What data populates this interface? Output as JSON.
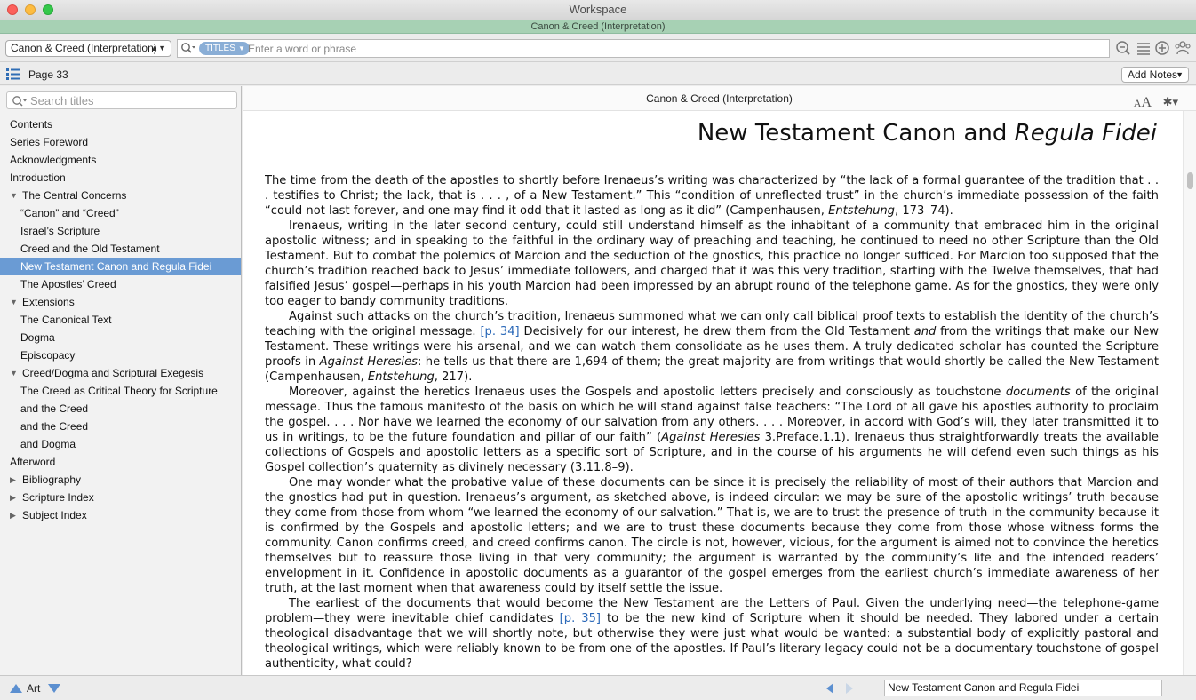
{
  "window": {
    "title": "Workspace",
    "panel_title": "Canon & Creed (Interpretation)"
  },
  "toolbar": {
    "resource_select": "Canon & Creed (Interpretation)",
    "search_scope": "TITLES",
    "search_placeholder": "Enter a word or phrase"
  },
  "pagebar": {
    "page_label": "Page 33",
    "add_notes": "Add Notes"
  },
  "sidebar": {
    "search_placeholder": "Search titles",
    "items": [
      {
        "label": "Contents",
        "level": 0,
        "arrow": "",
        "selected": false
      },
      {
        "label": "Series Foreword",
        "level": 0,
        "arrow": "",
        "selected": false
      },
      {
        "label": "Acknowledgments",
        "level": 0,
        "arrow": "",
        "selected": false
      },
      {
        "label": "Introduction",
        "level": 0,
        "arrow": "",
        "selected": false
      },
      {
        "label": "The Central Concerns",
        "level": 1,
        "arrow": "▼",
        "selected": false
      },
      {
        "label": "“Canon” and “Creed”",
        "level": 2,
        "arrow": "",
        "selected": false
      },
      {
        "label": "Israel’s Scripture",
        "level": 2,
        "arrow": "",
        "selected": false
      },
      {
        "label": "Creed and the Old Testament",
        "level": 2,
        "arrow": "",
        "selected": false
      },
      {
        "label": "New Testament Canon and Regula Fidei",
        "level": 2,
        "arrow": "",
        "selected": true
      },
      {
        "label": "The Apostles’ Creed",
        "level": 2,
        "arrow": "",
        "selected": false
      },
      {
        "label": "Extensions",
        "level": 1,
        "arrow": "▼",
        "selected": false
      },
      {
        "label": "The Canonical Text",
        "level": 2,
        "arrow": "",
        "selected": false
      },
      {
        "label": "Dogma",
        "level": 2,
        "arrow": "",
        "selected": false
      },
      {
        "label": "Episcopacy",
        "level": 2,
        "arrow": "",
        "selected": false
      },
      {
        "label": "Creed/Dogma and Scriptural Exegesis",
        "level": 1,
        "arrow": "▼",
        "selected": false
      },
      {
        "label": "The Creed as Critical Theory for Scripture",
        "level": 2,
        "arrow": "",
        "selected": false
      },
      {
        "label": "and the Creed",
        "level": 2,
        "arrow": "",
        "selected": false
      },
      {
        "label": "and the Creed",
        "level": 2,
        "arrow": "",
        "selected": false
      },
      {
        "label": "and Dogma",
        "level": 2,
        "arrow": "",
        "selected": false
      },
      {
        "label": "Afterword",
        "level": 0,
        "arrow": "",
        "selected": false
      },
      {
        "label": "Bibliography",
        "level": 1,
        "arrow": "▶",
        "selected": false
      },
      {
        "label": "Scripture Index",
        "level": 1,
        "arrow": "▶",
        "selected": false
      },
      {
        "label": "Subject Index",
        "level": 1,
        "arrow": "▶",
        "selected": false
      }
    ]
  },
  "document": {
    "header": "Canon & Creed (Interpretation)",
    "title_plain": "New Testament Canon and ",
    "title_italic": "Regula Fidei",
    "paragraphs": [
      {
        "indent": false,
        "segments": [
          {
            "t": "The time from the death of the apostles to shortly before Irenaeus’s writing was characterized by “the lack of a formal guarantee of the tradition that . . . testifies to Christ; the lack, that is . . . , of a New Testament.” This “condition of unreflected trust” in the church’s immediate possession of the faith “could not last forever, and one may find it odd that it lasted as long as it did” (Campenhausen, ",
            "s": "n"
          },
          {
            "t": "Entstehung",
            "s": "i"
          },
          {
            "t": ", 173–74).",
            "s": "n"
          }
        ]
      },
      {
        "indent": true,
        "segments": [
          {
            "t": "Irenaeus, writing in the later second century, could still understand himself as the inhabitant of a community that embraced him in the original apostolic witness; and in speaking to the faithful in the ordinary way of preaching and teaching, he continued to need no other Scripture than the Old Testament. But to combat the polemics of Marcion and the seduction of the gnostics, this practice no longer sufficed. For Marcion too supposed that the church’s tradition reached back to Jesus’ immediate followers, and charged that it was this very tradition, starting with the Twelve themselves, that had falsified Jesus’ gospel—perhaps in his youth Marcion had been impressed by an abrupt round of the telephone game. As for the gnostics, they were only too eager to bandy community traditions.",
            "s": "n"
          }
        ]
      },
      {
        "indent": true,
        "segments": [
          {
            "t": "Against such attacks on the church’s tradition, Irenaeus summoned what we can only call biblical proof texts to establish the identity of the church’s teaching with the original message. ",
            "s": "n"
          },
          {
            "t": "[p. 34]",
            "s": "l"
          },
          {
            "t": " Decisively for our interest, he drew them from the Old Testament ",
            "s": "n"
          },
          {
            "t": "and",
            "s": "i"
          },
          {
            "t": " from the writings that make our New Testament. These writings were his arsenal, and we can watch them consolidate as he uses them. A truly dedicated scholar has counted the Scripture proofs in ",
            "s": "n"
          },
          {
            "t": "Against Heresies",
            "s": "i"
          },
          {
            "t": ": he tells us that there are 1,694 of them; the great majority are from writings that would shortly be called the New Testament (Campenhausen, ",
            "s": "n"
          },
          {
            "t": "Entstehung",
            "s": "i"
          },
          {
            "t": ", 217).",
            "s": "n"
          }
        ]
      },
      {
        "indent": true,
        "segments": [
          {
            "t": "Moreover, against the heretics Irenaeus uses the Gospels and apostolic letters precisely and consciously as touchstone ",
            "s": "n"
          },
          {
            "t": "documents",
            "s": "i"
          },
          {
            "t": " of the original message. Thus the famous manifesto of the basis on which he will stand against false teachers: “The Lord of all gave his apostles authority to proclaim the gospel. . . . Nor have we learned the economy of our salvation from any others. . . . Moreover, in accord with God’s will, they later transmitted it to us in writings, to be the future foundation and pillar of our faith” (",
            "s": "n"
          },
          {
            "t": "Against Heresies",
            "s": "i"
          },
          {
            "t": " 3.Preface.1.1). Irenaeus thus straightforwardly treats the available collections of Gospels and apostolic letters as a specific sort of Scripture, and in the course of his arguments he will defend even such things as his Gospel collection’s quaternity as divinely necessary (3.11.8–9).",
            "s": "n"
          }
        ]
      },
      {
        "indent": true,
        "segments": [
          {
            "t": "One may wonder what the probative value of these documents can be since it is precisely the reliability of most of their authors that Marcion and the gnostics had put in question. Irenaeus’s argument, as sketched above, is indeed circular: we may be sure of the apostolic writings’ truth because they come from those from whom “we learned the economy of our salvation.” That is, we are to trust the presence of truth in the community because it is confirmed by the Gospels and apostolic letters; and we are to trust these documents because they come from those whose witness forms the community. Canon confirms creed, and creed confirms canon. The circle is not, however, vicious, for the argument is aimed not to convince the heretics themselves but to reassure those living in that very community; the argument is warranted by the community’s life and the intended readers’ envelopment in it. Confidence in apostolic documents as a guarantor of the gospel emerges from the earliest church’s immediate awareness of her truth, at the last moment when that awareness could by itself settle the issue.",
            "s": "n"
          }
        ]
      },
      {
        "indent": true,
        "segments": [
          {
            "t": "The earliest of the documents that would become the New Testament are the Letters of Paul. Given the underlying need—the telephone-game problem—they were inevitable chief candidates ",
            "s": "n"
          },
          {
            "t": "[p. 35]",
            "s": "l"
          },
          {
            "t": " to be the new kind of Scripture when it should be needed. They labored under a certain theological disadvantage that we will shortly note, but otherwise they were just what would be wanted: a substantial body of explicitly pastoral and theological writings, which were reliably known to be from one of the apostles. If Paul’s literary legacy could not be a documentary touchstone of gospel authenticity, what could?",
            "s": "n"
          }
        ]
      }
    ]
  },
  "bottombar": {
    "art_label": "Art",
    "location": "New Testament Canon and Regula Fidei"
  },
  "colors": {
    "accent_selection": "#6a9bd4",
    "panel_strip": "#a7d1b4",
    "link": "#2a68b8"
  }
}
